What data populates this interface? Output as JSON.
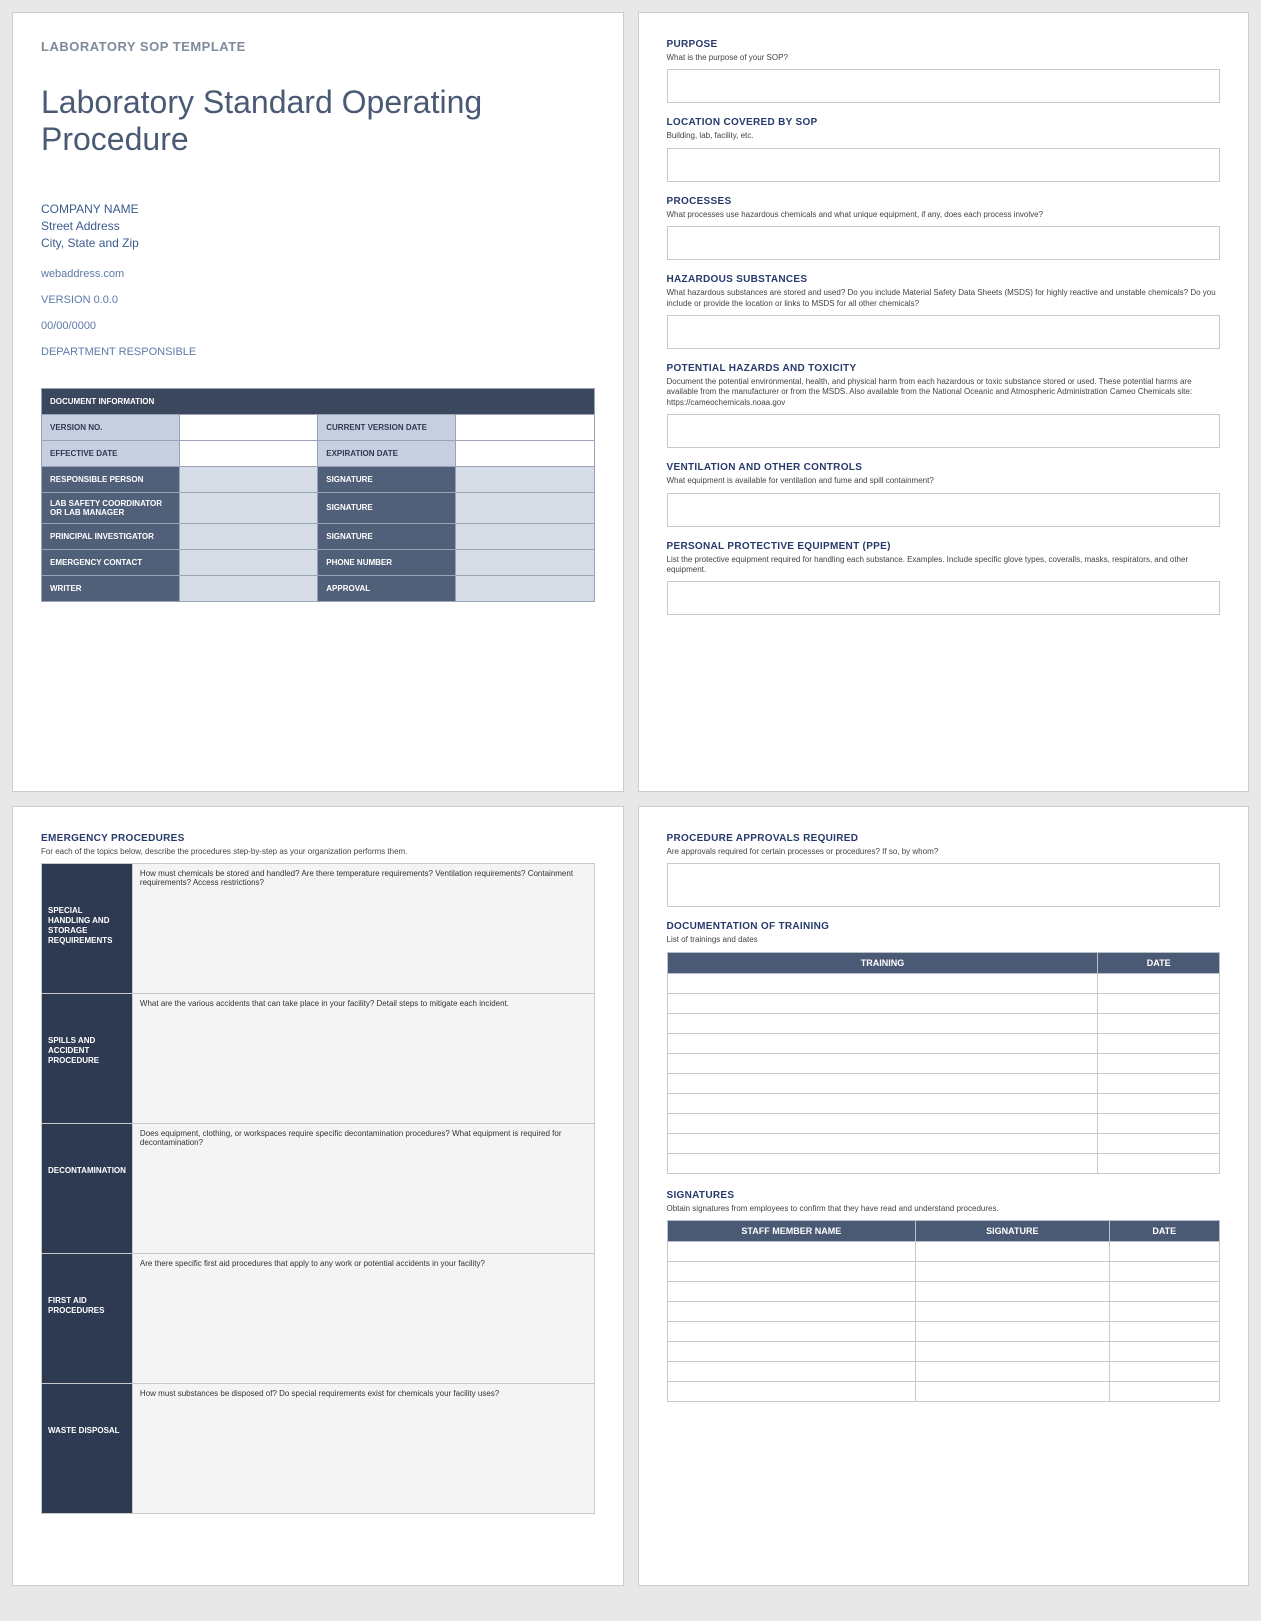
{
  "page1": {
    "template_label": "LABORATORY SOP TEMPLATE",
    "title": "Laboratory Standard Operating Procedure",
    "company": "COMPANY NAME",
    "street": "Street Address",
    "citystate": "City, State and Zip",
    "web": "webaddress.com",
    "version": "VERSION 0.0.0",
    "date": "00/00/0000",
    "dept": "DEPARTMENT RESPONSIBLE",
    "docinfo_header": "DOCUMENT INFORMATION",
    "rows": {
      "version_no": "VERSION NO.",
      "current_version_date": "CURRENT VERSION DATE",
      "effective_date": "EFFECTIVE DATE",
      "expiration_date": "EXPIRATION DATE",
      "responsible_person": "RESPONSIBLE PERSON",
      "signature1": "SIGNATURE",
      "lab_safety": "LAB SAFETY COORDINATOR OR LAB MANAGER",
      "signature2": "SIGNATURE",
      "pi": "PRINCIPAL INVESTIGATOR",
      "signature3": "SIGNATURE",
      "emergency_contact": "EMERGENCY CONTACT",
      "phone": "PHONE NUMBER",
      "writer": "WRITER",
      "approval": "APPROVAL"
    }
  },
  "page2": {
    "purpose_t": "PURPOSE",
    "purpose_d": "What is the purpose of your SOP?",
    "location_t": "LOCATION COVERED BY SOP",
    "location_d": "Building, lab, facility, etc.",
    "processes_t": "PROCESSES",
    "processes_d": "What processes use hazardous chemicals and what unique equipment, if any, does each process involve?",
    "hazsub_t": "HAZARDOUS SUBSTANCES",
    "hazsub_d": "What hazardous substances are stored and used? Do you include Material Safety Data Sheets (MSDS) for highly reactive and unstable chemicals? Do you include or provide the location or links to MSDS for all other chemicals?",
    "pothaz_t": "POTENTIAL HAZARDS AND TOXICITY",
    "pothaz_d": "Document the potential environmental, health, and physical harm from each hazardous or toxic substance stored or used. These potential harms are available from the manufacturer or from the MSDS. Also available from the National Oceanic and Atmospheric Administration Cameo Chemicals site: https://cameochemicals.noaa.gov",
    "vent_t": "VENTILATION AND OTHER CONTROLS",
    "vent_d": "What equipment is available for ventilation and fume and spill containment?",
    "ppe_t": "PERSONAL PROTECTIVE EQUIPMENT (PPE)",
    "ppe_d": "List the protective equipment required for handling each substance. Examples. Include specific glove types, coveralls, masks, respirators, and other equipment."
  },
  "page3": {
    "title": "EMERGENCY PROCEDURES",
    "desc": "For each of the topics below, describe the procedures step-by-step as your organization performs them.",
    "rows": [
      {
        "label": "SPECIAL HANDLING AND STORAGE REQUIREMENTS",
        "prompt": "How must chemicals be stored and handled? Are there temperature requirements? Ventilation requirements? Containment requirements? Access restrictions?"
      },
      {
        "label": "SPILLS AND ACCIDENT PROCEDURE",
        "prompt": "What are the various accidents that can take place in your facility? Detail steps to mitigate each incident."
      },
      {
        "label": "DECONTAMINATION",
        "prompt": "Does equipment, clothing, or workspaces require specific decontamination procedures? What equipment is required for decontamination?"
      },
      {
        "label": "FIRST AID PROCEDURES",
        "prompt": "Are there specific first aid procedures that apply to any work or potential accidents in your facility?"
      },
      {
        "label": "WASTE DISPOSAL",
        "prompt": "How must substances be disposed of? Do special requirements exist for chemicals your facility uses?"
      }
    ]
  },
  "page4": {
    "approvals_t": "PROCEDURE APPROVALS REQUIRED",
    "approvals_d": "Are approvals required for certain processes or procedures?  If so, by whom?",
    "training_t": "DOCUMENTATION OF TRAINING",
    "training_d": "List of trainings and dates",
    "training_cols": {
      "c1": "TRAINING",
      "c2": "DATE"
    },
    "sig_t": "SIGNATURES",
    "sig_d": "Obtain signatures from employees to confirm that they have read and understand procedures.",
    "sig_cols": {
      "c1": "STAFF MEMBER NAME",
      "c2": "SIGNATURE",
      "c3": "DATE"
    }
  }
}
